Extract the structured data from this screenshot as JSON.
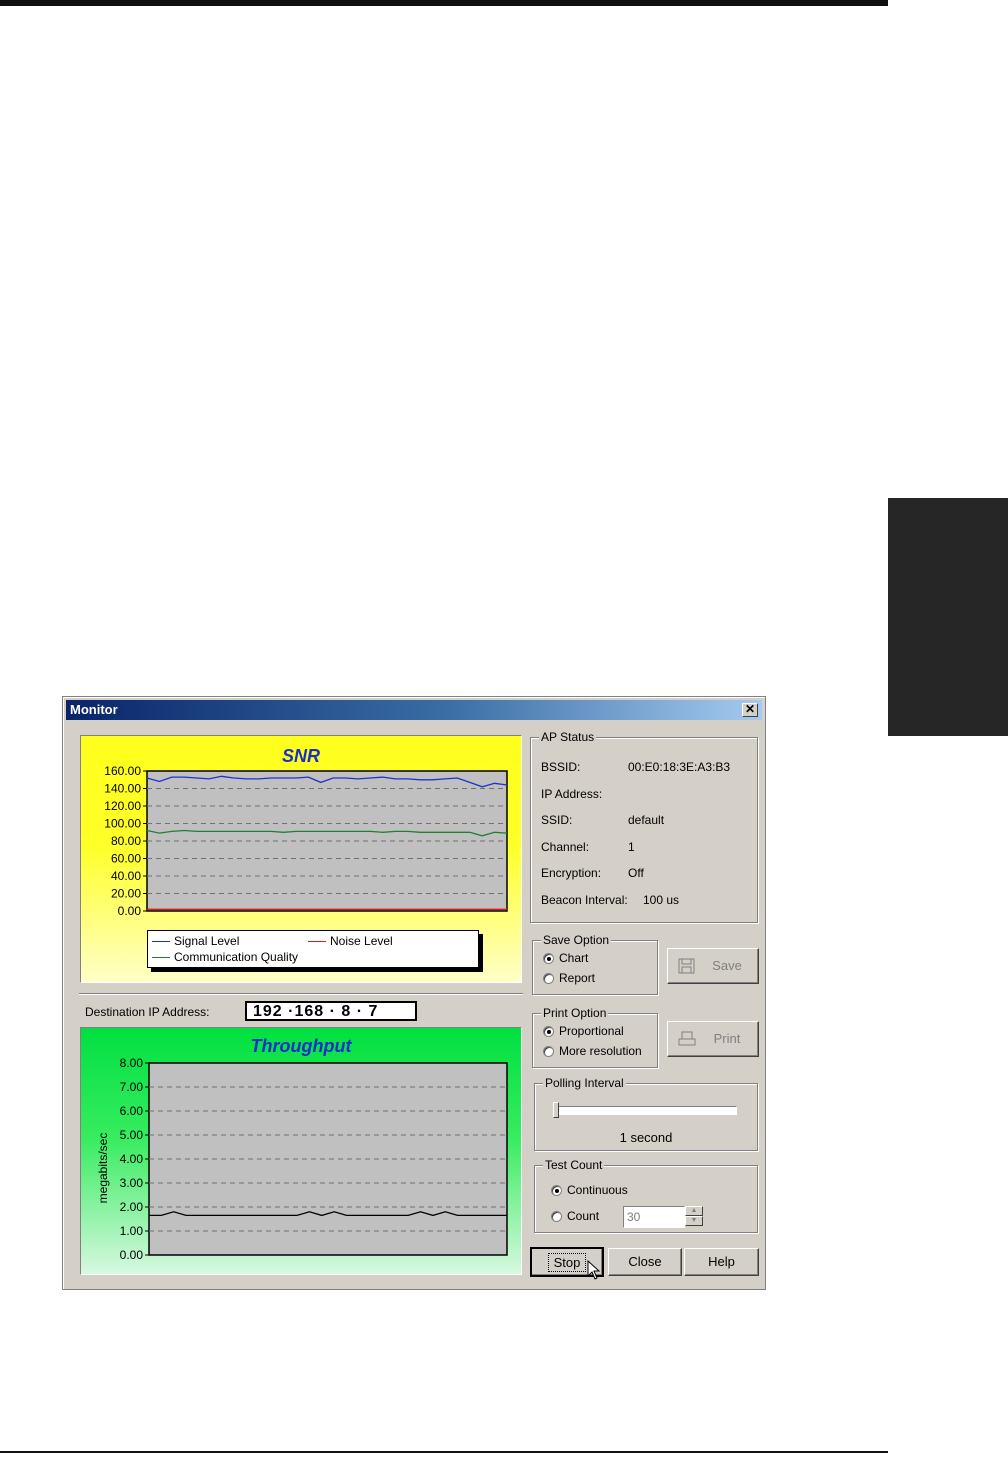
{
  "window": {
    "title": "Monitor",
    "close_glyph": "✕"
  },
  "snr_chart": {
    "title": "SNR",
    "legend": {
      "signal": "Signal Level",
      "noise": "Noise Level",
      "quality": "Communication Quality"
    }
  },
  "destination": {
    "label": "Destination IP Address:",
    "ip": "192 ·168 ·  8  ·  7"
  },
  "throughput_chart": {
    "title": "Throughput",
    "ylabel": "megabits/sec"
  },
  "ap_status": {
    "title": "AP Status",
    "rows": [
      {
        "label": "BSSID:",
        "value": "00:E0:18:3E:A3:B3"
      },
      {
        "label": "IP Address:",
        "value": ""
      },
      {
        "label": "SSID:",
        "value": "default"
      },
      {
        "label": "Channel:",
        "value": "1"
      },
      {
        "label": "Encryption:",
        "value": "Off"
      },
      {
        "label": "Beacon Interval:",
        "value": "100 us"
      }
    ]
  },
  "save_option": {
    "title": "Save Option",
    "chart": "Chart",
    "report": "Report",
    "selected": "chart",
    "button": "Save"
  },
  "print_option": {
    "title": "Print Option",
    "proportional": "Proportional",
    "more": "More resolution",
    "selected": "proportional",
    "button": "Print"
  },
  "polling": {
    "title": "Polling Interval",
    "value_text": "1 second",
    "level": 0
  },
  "test_count": {
    "title": "Test Count",
    "continuous": "Continuous",
    "count": "Count",
    "count_value": "30",
    "selected": "continuous"
  },
  "buttons": {
    "stop": "Stop",
    "close": "Close",
    "help": "Help"
  },
  "colors": {
    "signal": "#2030d0",
    "noise": "#e01818",
    "quality": "#208030",
    "throughput": "#000000",
    "title_blue": "#1830c8"
  },
  "chart_data": [
    {
      "type": "line",
      "title": "SNR",
      "ylim": [
        0,
        160
      ],
      "yticks": [
        "160.00",
        "140.00",
        "120.00",
        "100.00",
        "80.00",
        "60.00",
        "40.00",
        "20.00",
        "0.00"
      ],
      "grid": true,
      "legend_position": "bottom",
      "x": [
        1,
        2,
        3,
        4,
        5,
        6,
        7,
        8,
        9,
        10,
        11,
        12,
        13,
        14,
        15,
        16,
        17,
        18,
        19,
        20,
        21,
        22,
        23,
        24,
        25,
        26,
        27,
        28,
        29,
        30
      ],
      "series": [
        {
          "name": "Signal Level",
          "values": [
            152,
            148,
            153,
            153,
            152,
            151,
            154,
            152,
            151,
            151,
            152,
            152,
            152,
            153,
            147,
            152,
            152,
            151,
            152,
            153,
            151,
            151,
            150,
            150,
            151,
            152,
            147,
            142,
            146,
            144
          ]
        },
        {
          "name": "Noise Level",
          "values": [
            2,
            2,
            2,
            2,
            2,
            2,
            2,
            2,
            2,
            2,
            2,
            2,
            2,
            2,
            2,
            2,
            2,
            2,
            2,
            2,
            2,
            2,
            2,
            2,
            2,
            2,
            2,
            2,
            2,
            2
          ]
        },
        {
          "name": "Communication Quality",
          "values": [
            92,
            89,
            91,
            92,
            91,
            91,
            91,
            91,
            91,
            91,
            91,
            90,
            91,
            91,
            91,
            91,
            91,
            91,
            91,
            90,
            91,
            91,
            90,
            90,
            90,
            90,
            90,
            86,
            90,
            89
          ]
        }
      ]
    },
    {
      "type": "line",
      "title": "Throughput",
      "ylabel": "megabits/sec",
      "ylim": [
        0,
        8
      ],
      "yticks": [
        "8.00",
        "7.00",
        "6.00",
        "5.00",
        "4.00",
        "3.00",
        "2.00",
        "1.00",
        "0.00"
      ],
      "grid": true,
      "x": [
        1,
        2,
        3,
        4,
        5,
        6,
        7,
        8,
        9,
        10,
        11,
        12,
        13,
        14,
        15,
        16,
        17,
        18,
        19,
        20,
        21,
        22,
        23,
        24,
        25,
        26,
        27,
        28,
        29,
        30
      ],
      "series": [
        {
          "values": [
            1.65,
            1.65,
            1.8,
            1.65,
            1.65,
            1.65,
            1.65,
            1.65,
            1.65,
            1.65,
            1.65,
            1.65,
            1.65,
            1.8,
            1.65,
            1.8,
            1.65,
            1.65,
            1.65,
            1.65,
            1.65,
            1.65,
            1.8,
            1.65,
            1.8,
            1.65,
            1.65,
            1.65,
            1.65,
            1.65
          ]
        }
      ]
    }
  ]
}
